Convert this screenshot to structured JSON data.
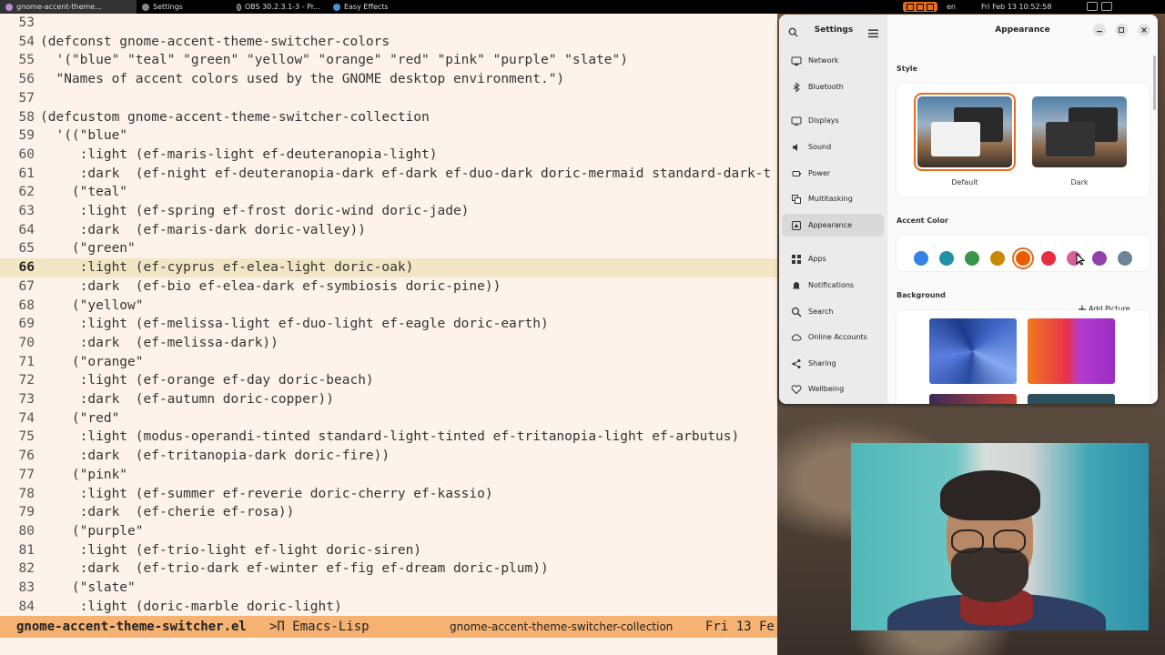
{
  "taskbar": {
    "tasks": [
      {
        "label": "gnome-accent-theme...",
        "active": true
      },
      {
        "label": "Settings",
        "active": false
      },
      {
        "label": "OBS 30.2.3.1-3 - Pr...",
        "active": false
      },
      {
        "label": "Easy Effects",
        "active": false
      }
    ],
    "lang": "en",
    "clock": "Fri Feb 13 10:52:58"
  },
  "emacs": {
    "lines": [
      {
        "n": "53",
        "t": ""
      },
      {
        "n": "54",
        "t": "(defconst gnome-accent-theme-switcher-colors"
      },
      {
        "n": "55",
        "t": "  '(\"blue\" \"teal\" \"green\" \"yellow\" \"orange\" \"red\" \"pink\" \"purple\" \"slate\")"
      },
      {
        "n": "56",
        "t": "  \"Names of accent colors used by the GNOME desktop environment.\")"
      },
      {
        "n": "57",
        "t": ""
      },
      {
        "n": "58",
        "t": "(defcustom gnome-accent-theme-switcher-collection"
      },
      {
        "n": "59",
        "t": "  '((\"blue\""
      },
      {
        "n": "60",
        "t": "     :light (ef-maris-light ef-deuteranopia-light)"
      },
      {
        "n": "61",
        "t": "     :dark  (ef-night ef-deuteranopia-dark ef-dark ef-duo-dark doric-mermaid standard-dark-t"
      },
      {
        "n": "62",
        "t": "    (\"teal\""
      },
      {
        "n": "63",
        "t": "     :light (ef-spring ef-frost doric-wind doric-jade)"
      },
      {
        "n": "64",
        "t": "     :dark  (ef-maris-dark doric-valley))"
      },
      {
        "n": "65",
        "t": "    (\"green\""
      },
      {
        "n": "66",
        "t": "     :light (ef-cyprus ef-elea-light doric-oak)"
      },
      {
        "n": "67",
        "t": "     :dark  (ef-bio ef-elea-dark ef-symbiosis doric-pine))"
      },
      {
        "n": "68",
        "t": "    (\"yellow\""
      },
      {
        "n": "69",
        "t": "     :light (ef-melissa-light ef-duo-light ef-eagle doric-earth)"
      },
      {
        "n": "70",
        "t": "     :dark  (ef-melissa-dark))"
      },
      {
        "n": "71",
        "t": "    (\"orange\""
      },
      {
        "n": "72",
        "t": "     :light (ef-orange ef-day doric-beach)"
      },
      {
        "n": "73",
        "t": "     :dark  (ef-autumn doric-copper))"
      },
      {
        "n": "74",
        "t": "    (\"red\""
      },
      {
        "n": "75",
        "t": "     :light (modus-operandi-tinted standard-light-tinted ef-tritanopia-light ef-arbutus)"
      },
      {
        "n": "76",
        "t": "     :dark  (ef-tritanopia-dark doric-fire))"
      },
      {
        "n": "77",
        "t": "    (\"pink\""
      },
      {
        "n": "78",
        "t": "     :light (ef-summer ef-reverie doric-cherry ef-kassio)"
      },
      {
        "n": "79",
        "t": "     :dark  (ef-cherie ef-rosa))"
      },
      {
        "n": "80",
        "t": "    (\"purple\""
      },
      {
        "n": "81",
        "t": "     :light (ef-trio-light ef-light doric-siren)"
      },
      {
        "n": "82",
        "t": "     :dark  (ef-trio-dark ef-winter ef-fig ef-dream doric-plum))"
      },
      {
        "n": "83",
        "t": "    (\"slate\""
      },
      {
        "n": "84",
        "t": "     :light (doric-marble doric-light)"
      }
    ],
    "current_line": "66",
    "modeline": {
      "file": "gnome-accent-theme-switcher.el",
      "mode": ">Π Emacs-Lisp",
      "function": "gnome-accent-theme-switcher-collection",
      "date": "Fri 13 Fe"
    }
  },
  "settings": {
    "sidebar_title": "Settings",
    "page_title": "Appearance",
    "sidebar": [
      {
        "label": "Network",
        "icon": "network-icon"
      },
      {
        "label": "Bluetooth",
        "icon": "bluetooth-icon"
      },
      {
        "label": "Displays",
        "icon": "display-icon"
      },
      {
        "label": "Sound",
        "icon": "sound-icon"
      },
      {
        "label": "Power",
        "icon": "power-icon"
      },
      {
        "label": "Multitasking",
        "icon": "multitasking-icon"
      },
      {
        "label": "Appearance",
        "icon": "appearance-icon",
        "active": true
      },
      {
        "label": "Apps",
        "icon": "apps-icon"
      },
      {
        "label": "Notifications",
        "icon": "bell-icon"
      },
      {
        "label": "Search",
        "icon": "search-icon"
      },
      {
        "label": "Online Accounts",
        "icon": "cloud-icon"
      },
      {
        "label": "Sharing",
        "icon": "share-icon"
      },
      {
        "label": "Wellbeing",
        "icon": "wellbeing-icon"
      }
    ],
    "style": {
      "heading": "Style",
      "options": [
        {
          "label": "Default",
          "selected": true
        },
        {
          "label": "Dark",
          "selected": false
        }
      ]
    },
    "accent": {
      "heading": "Accent Color",
      "colors": [
        "#3584e4",
        "#2190a4",
        "#3a944a",
        "#c88800",
        "#ed5b00",
        "#e62d42",
        "#d56199",
        "#9141ac",
        "#6f8396"
      ],
      "selected_index": 4
    },
    "background": {
      "heading": "Background",
      "add_label": "Add Picture…"
    }
  }
}
